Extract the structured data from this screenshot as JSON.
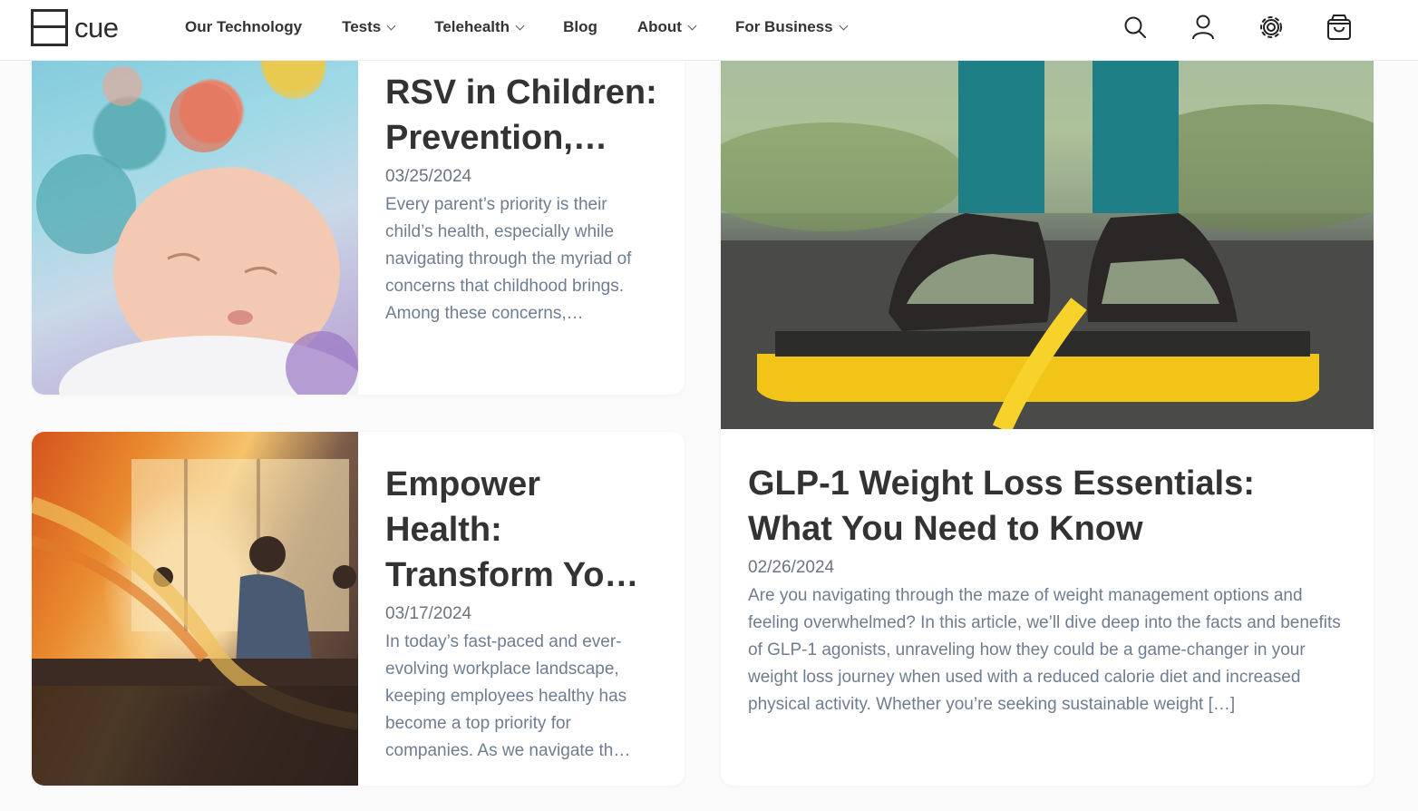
{
  "brand": {
    "name": "cue"
  },
  "nav": [
    {
      "label": "Our Technology",
      "dropdown": false
    },
    {
      "label": "Tests",
      "dropdown": true
    },
    {
      "label": "Telehealth",
      "dropdown": true
    },
    {
      "label": "Blog",
      "dropdown": false
    },
    {
      "label": "About",
      "dropdown": true
    },
    {
      "label": "For Business",
      "dropdown": true
    }
  ],
  "header_icons": [
    "search-icon",
    "user-icon",
    "gear-icon",
    "shopping-bag-icon"
  ],
  "posts": [
    {
      "title": "RSV in Children: Prevention,…",
      "date": "03/25/2024",
      "excerpt": "Every parent’s priority is their child’s health, especially while navigating through the myriad of concerns that childhood brings. Among these concerns,…"
    },
    {
      "title": "Empower Health: Transform Yo…",
      "date": "03/17/2024",
      "excerpt": "In today’s fast-paced and ever-evolving workplace landscape, keeping employees healthy has become a top priority for companies. As we navigate th…"
    },
    {
      "title": "GLP-1 Weight Loss Essentials: What You Need to Know",
      "date": "02/26/2024",
      "excerpt": "Are you navigating through the maze of weight management options and feeling overwhelmed? In this article, we’ll dive deep into the facts and benefits of GLP-1 agonists, unraveling how they could be a game-changer in your weight loss journey when used with a reduced calorie diet and increased physical activity. Whether you’re seeking sustainable weight […]"
    }
  ]
}
